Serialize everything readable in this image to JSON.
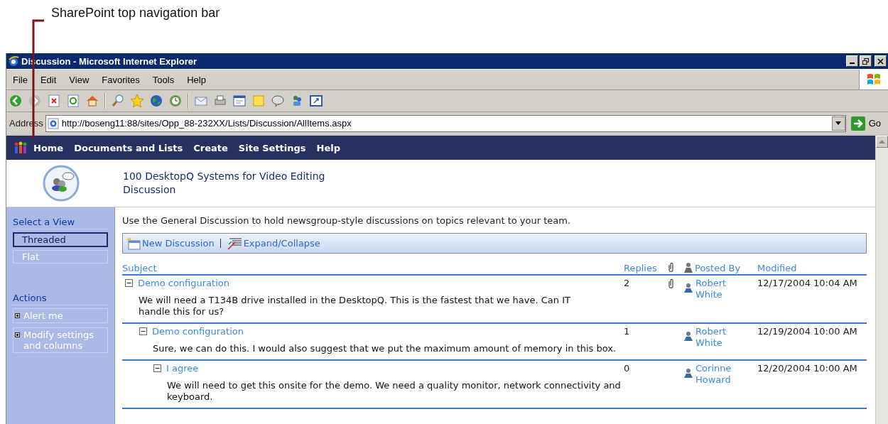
{
  "callout": {
    "text": "SharePoint top navigation bar"
  },
  "window": {
    "title": "Discussion - Microsoft Internet Explorer"
  },
  "menu": [
    "File",
    "Edit",
    "View",
    "Favorites",
    "Tools",
    "Help"
  ],
  "address": {
    "label": "Address",
    "url": "http://boseng11:88/sites/Opp_88-232XX/Lists/Discussion/AllItems.aspx",
    "go": "Go"
  },
  "top_nav": [
    "Home",
    "Documents and Lists",
    "Create",
    "Site Settings",
    "Help"
  ],
  "site": {
    "title": "100 DesktopQ Systems for Video Editing",
    "list": "Discussion"
  },
  "sidebar": {
    "views_title": "Select a View",
    "views": [
      {
        "label": "Threaded",
        "selected": true
      },
      {
        "label": "Flat",
        "selected": false
      }
    ],
    "actions_title": "Actions",
    "actions": [
      "Alert me",
      "Modify settings and columns"
    ]
  },
  "description": "Use the General Discussion to hold newsgroup-style discussions on topics relevant to your team.",
  "toolbar": [
    "New Discussion",
    "Expand/Collapse"
  ],
  "columns": {
    "subject": "Subject",
    "replies": "Replies",
    "posted_by": "Posted By",
    "modified": "Modified"
  },
  "threads": [
    {
      "subject": "Demo configuration",
      "expanded": true,
      "body": "We will need a T134B drive installed in the DesktopQ. This is the fastest that we have. Can IT handle this for us?",
      "replies": "2",
      "attachment": true,
      "posted_by": "Robert White",
      "modified": "12/17/2004 10:04 AM",
      "children": [
        {
          "subject": "Demo configuration",
          "expanded": true,
          "body": "Sure, we can do this. I would also suggest that we put the maximum amount of memory in this box.",
          "replies": "1",
          "attachment": false,
          "posted_by": "Robert White",
          "modified": "12/19/2004 10:00 AM",
          "children": [
            {
              "subject": "I agree",
              "expanded": true,
              "body": "We will need to get this onsite for the demo. We need a quality monitor, network connectivity and keyboard.",
              "replies": "0",
              "attachment": false,
              "posted_by": "Corinne Howard",
              "modified": "12/20/2004 10:00 AM"
            }
          ]
        }
      ]
    }
  ]
}
